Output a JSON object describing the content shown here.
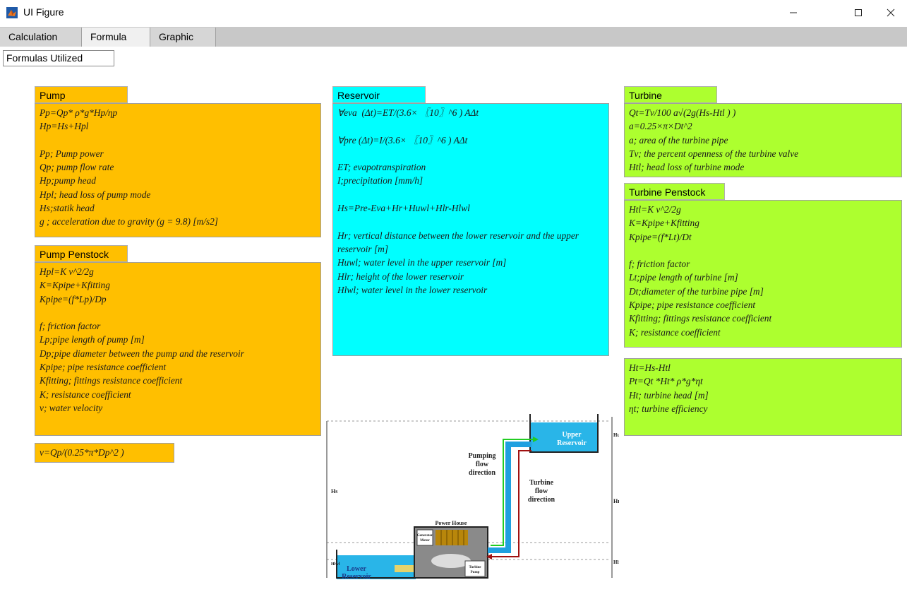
{
  "window": {
    "title": "UI Figure",
    "icon": "matlab-icon"
  },
  "tabs": [
    {
      "label": "Calculation"
    },
    {
      "label": "Formula"
    },
    {
      "label": "Graphic"
    }
  ],
  "formulas_label": "Formulas Utilized",
  "pump": {
    "header": "Pump",
    "text": "Pp=Qp* ρ*g*Hp/ηp\nHp=Hs+Hpl\n\nPp; Pump power\nQp; pump flow rate\nHp;pump head\nHpl; head loss of pump mode\nHs;statik head\ng ; acceleration due to gravity (g = 9.8) [m/s2]"
  },
  "pump_penstock": {
    "header": "Pump Penstock",
    "text": "Hpl=K v^2/2g\nK=Kpipe+Kfitting\nKpipe=(f*Lp)/Dp\n\nf; friction factor\nLp;pipe length of pump [m]\nDp;pipe diameter between the pump and the reservoir\nKpipe; pipe resistance coefficient\nKfitting; fittings resistance coefficient\nK; resistance coefficient\nv; water velocity"
  },
  "velocity_formula": "v=Qp/(0.25*π*Dp^2 )",
  "reservoir": {
    "header": "Reservoir",
    "text": "∀eva  (Δt)=ET/(3.6× 〖10〗^6 ) AΔt\n\n∀pre (Δt)=I/(3.6× 〖10〗^6 ) AΔt\n\nET; evapotranspiration\nI;precipitation [mm/h]\n\nHs=Pre-Eva+Hr+Huwl+Hlr-Hlwl\n\nHr; vertical distance between the lower reservoir and the upper reservoir [m]\nHuwl; water level in the upper reservoir [m]\nHlr; height of the lower reservoir\nHlwl; water level in the lower reservoir"
  },
  "turbine": {
    "header": "Turbine",
    "text": "Qt=Tv/100 a√(2g(Hs-Htl ) )\na=0.25×π×Dt^2\na; area of the turbine pipe\nTv; the percent openness of the turbine valve\nHtl; head loss of turbine mode"
  },
  "turbine_penstock": {
    "header": "Turbine Penstock",
    "text": "Htl=K v^2/2g\nK=Kpipe+Kfitting\nKpipe=(f*Lt)/Dt\n\nf; friction factor\nLt;pipe length of turbine [m]\nDt;diameter of the turbine pipe [m]\nKpipe; pipe resistance coefficient\nKfitting; fittings resistance coefficient\nK; resistance coefficient"
  },
  "turbine_power": {
    "text": "Ht=Hs-Htl\nPt=Qt *Ht* ρ*g*ηt\nHt; turbine head [m]\nηt; turbine efficiency"
  },
  "diagram": {
    "upper_reservoir_l1": "Upper",
    "upper_reservoir_l2": "Reservoir",
    "lower_reservoir_l1": "Lower",
    "lower_reservoir_l2": "Reservoir",
    "pumping_l1": "Pumping",
    "pumping_l2": "flow",
    "pumping_l3": "direction",
    "turbine_l1": "Turbine",
    "turbine_l2": "flow",
    "turbine_l3": "direction",
    "power_house": "Power House",
    "generator_l1": "Generator",
    "generator_l2": "Motor",
    "turbine_pump_l1": "Turbine",
    "turbine_pump_l2": "Pump",
    "dim_hs": "Hs",
    "dim_hr": "Hr",
    "dim_huwl": "Huwl",
    "dim_hlwl": "Hlwl",
    "dim_hlr": "Hlr"
  }
}
